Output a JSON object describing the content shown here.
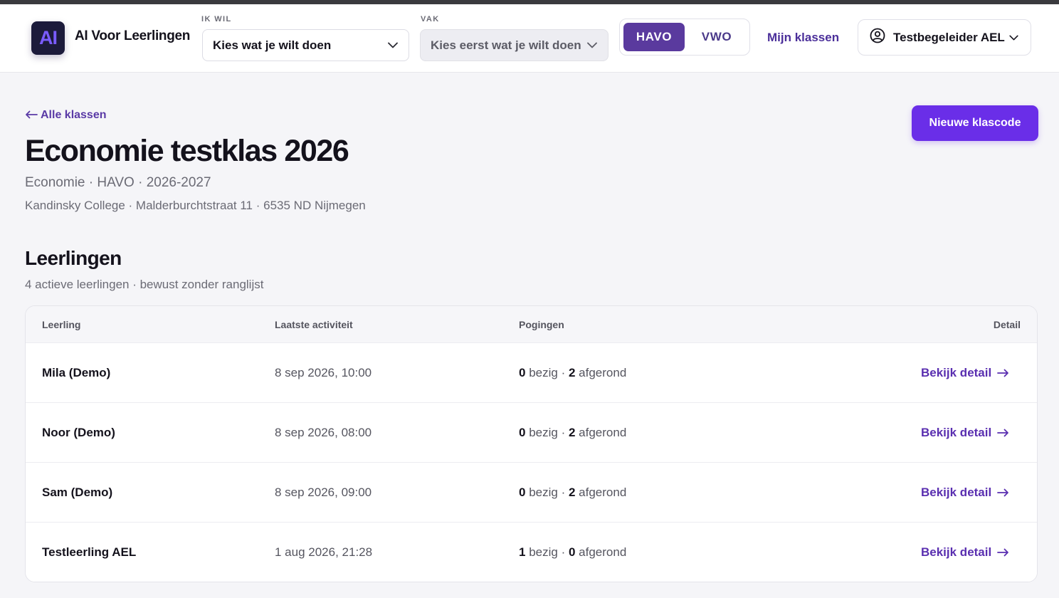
{
  "header": {
    "logo_text": "AI",
    "brand": "AI Voor Leerlingen",
    "ik_wil": {
      "label": "IK WIL",
      "value": "Kies wat je wilt doen"
    },
    "vak": {
      "label": "VAK",
      "value": "Kies eerst wat je wilt doen"
    },
    "levels": [
      {
        "label": "HAVO",
        "active": true
      },
      {
        "label": "VWO",
        "active": false
      }
    ],
    "nav_link": "Mijn klassen",
    "user_name": "Testbegeleider AEL"
  },
  "page": {
    "back_link": "Alle klassen",
    "title": "Economie testklas 2026",
    "meta_line_1": "Economie · HAVO · 2026-2027",
    "meta_line_2": "Kandinsky College · Malderburchtstraat 11 · 6535 ND Nijmegen",
    "new_code_button": "Nieuwe klascode"
  },
  "students": {
    "title": "Leerlingen",
    "subtitle": "4 actieve leerlingen · bewust zonder ranglijst",
    "columns": {
      "name": "Leerling",
      "last_activity": "Laatste activiteit",
      "attempts": "Pogingen",
      "detail": "Detail"
    },
    "rows": [
      {
        "name": "Mila (Demo)",
        "last_activity": "8 sep 2026, 10:00",
        "in_progress": "0",
        "in_progress_label": "bezig",
        "completed": "2",
        "completed_label": "afgerond",
        "detail": "Bekijk detail"
      },
      {
        "name": "Noor (Demo)",
        "last_activity": "8 sep 2026, 08:00",
        "in_progress": "0",
        "in_progress_label": "bezig",
        "completed": "2",
        "completed_label": "afgerond",
        "detail": "Bekijk detail"
      },
      {
        "name": "Sam (Demo)",
        "last_activity": "8 sep 2026, 09:00",
        "in_progress": "0",
        "in_progress_label": "bezig",
        "completed": "2",
        "completed_label": "afgerond",
        "detail": "Bekijk detail"
      },
      {
        "name": "Testleerling AEL",
        "last_activity": "1 aug 2026, 21:28",
        "in_progress": "1",
        "in_progress_label": "bezig",
        "completed": "0",
        "completed_label": "afgerond",
        "detail": "Bekijk detail"
      }
    ]
  },
  "colors": {
    "accent": "#6a2ee8",
    "accent_dark": "#5a3a9e",
    "link": "#5a2fb0",
    "background": "#f5f5f8"
  },
  "icons": {
    "back": "arrow-left-icon",
    "select": "chevron-down-icon",
    "user": "user-circle-icon",
    "detail": "arrow-right-icon"
  }
}
